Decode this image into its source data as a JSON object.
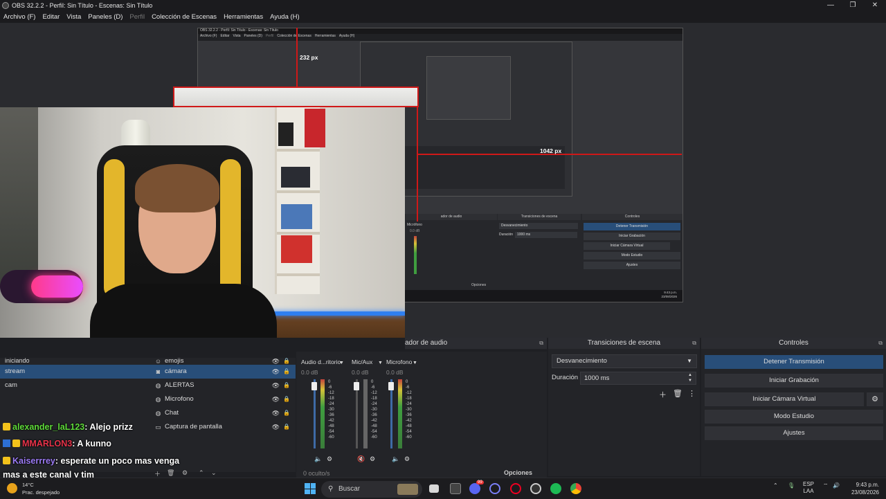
{
  "titlebar": {
    "title": "OBS 32.2.2 - Perfil: Sin Título - Escenas: Sin Título",
    "min": "—",
    "max": "❐",
    "close": "✕"
  },
  "menu": [
    "Archivo (F)",
    "Editar",
    "Vista",
    "Paneles (D)",
    "Perfil",
    "Colección de Escenas",
    "Herramientas",
    "Ayuda (H)"
  ],
  "preview": {
    "measure_top": "232 px",
    "measure_right": "1042 px",
    "nested_title": "OBS 32.2.2 - Perfil: Sin Título - Escenas: Sin Título",
    "nested_menu": [
      "Archivo (F)",
      "Editar",
      "Vista",
      "Paneles (D)",
      "Perfil",
      "Colección de Escenas",
      "Herramientas",
      "Ayuda (H)"
    ],
    "nested_mixer": "ador de audio",
    "nested_transitions": "Transiciones de escena",
    "nested_controls": "Controles",
    "nested_fade": "Desvanecimiento",
    "nested_duration": "Duración",
    "nested_duration_value": "1000 ms",
    "nested_buttons": [
      "Detener Transmisión",
      "Iniciar Grabación",
      "Iniciar Cámara Virtual",
      "Modo Estudio",
      "Ajustes"
    ],
    "nested_mic": "Micrófono",
    "nested_db": "0.0 dB",
    "nested_options": "Opciones",
    "nested_clock": "9:43 p.m.",
    "nested_date": "23/08/2026"
  },
  "scenes": {
    "items": [
      "iniciando",
      "stream",
      "cam"
    ],
    "active_index": 1
  },
  "sources": {
    "items": [
      {
        "icon": "emoji-icon",
        "glyph": "☺",
        "label": "emojis"
      },
      {
        "icon": "camera-icon",
        "glyph": "◙",
        "label": "cámara"
      },
      {
        "icon": "globe-icon",
        "glyph": "◍",
        "label": "ALERTAS"
      },
      {
        "icon": "globe-icon",
        "glyph": "◍",
        "label": "Microfono"
      },
      {
        "icon": "globe-icon",
        "glyph": "◍",
        "label": "Chat"
      },
      {
        "icon": "monitor-icon",
        "glyph": "▭",
        "label": "Captura de pantalla"
      }
    ],
    "active_index": 1,
    "eye": "👁",
    "lock": "🔒"
  },
  "mixer": {
    "header": "ador de audio",
    "channels": [
      {
        "name": "Audio d...ritorio",
        "db": "0.0 dB",
        "muted": false
      },
      {
        "name": "Mic/Aux",
        "db": "0.0 dB",
        "muted": true
      },
      {
        "name": "Microfono",
        "db": "0.0 dB",
        "muted": false
      }
    ],
    "scale": [
      "0",
      "-6",
      "-12",
      "-18",
      "-24",
      "-30",
      "-36",
      "-42",
      "-48",
      "-54",
      "-60"
    ],
    "hidden": "0 oculto/s",
    "options": "Opciones"
  },
  "transitions": {
    "header": "Transiciones de escena",
    "selected": "Desvanecimiento",
    "duration_label": "Duración",
    "duration_value": "1000 ms"
  },
  "controls": {
    "header": "Controles",
    "buttons": [
      "Detener Transmisión",
      "Iniciar Grabación",
      "Iniciar Cámara Virtual",
      "Modo Estudio",
      "Ajustes"
    ]
  },
  "chat": [
    {
      "user": "alexander_laL123",
      "color": "#5fdc3a",
      "message": ": Alejo prizz"
    },
    {
      "user": "MMARLON3",
      "color": "#e8334a",
      "message": ": A kunno"
    },
    {
      "user": "Kaiserrrey",
      "color": "#9c7bf5",
      "message": ": esperate un poco mas venga"
    },
    {
      "user": "",
      "color": "#ffffff",
      "message": "mas a este canal y tim"
    }
  ],
  "taskbar": {
    "temp": "14°C",
    "condition": "Prac. despejado",
    "search": "Buscar",
    "lang": "ESP",
    "layout": "LAA",
    "time": "9:43 p.m.",
    "date": "23/08/2026",
    "discord_badge": "99"
  },
  "colors": {
    "accent": "#284e79",
    "guide": "#d01818"
  }
}
